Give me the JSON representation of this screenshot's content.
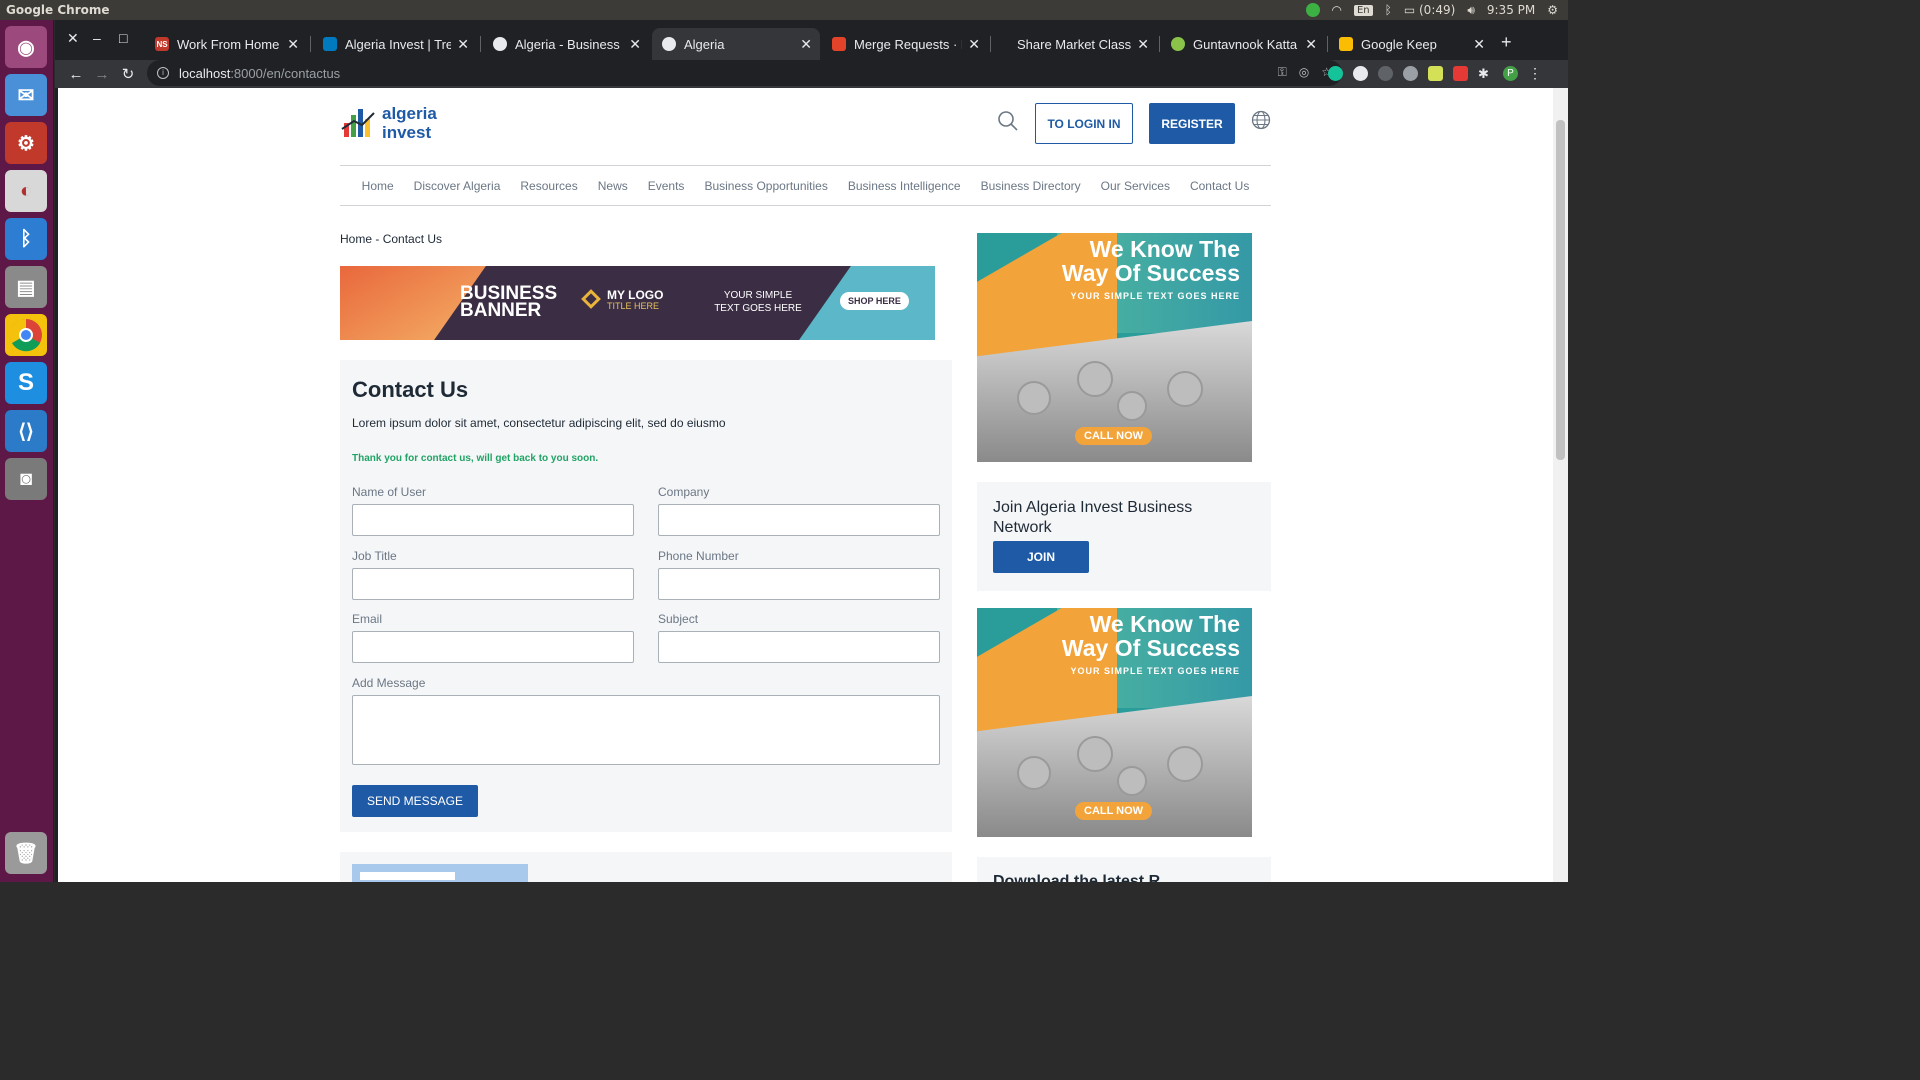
{
  "os": {
    "app_title": "Google Chrome",
    "battery": "(0:49)",
    "keyboard": "En",
    "clock": "9:35 PM"
  },
  "browser": {
    "tabs": [
      {
        "title": "Work From Home",
        "favicon": "NS"
      },
      {
        "title": "Algeria Invest | Trello"
      },
      {
        "title": "Algeria - Business Op"
      },
      {
        "title": "Algeria"
      },
      {
        "title": "Merge Requests · La"
      },
      {
        "title": "Share Market Classes"
      },
      {
        "title": "Guntavnook Katta"
      },
      {
        "title": "Google Keep"
      }
    ],
    "url_host": "localhost",
    "url_rest": ":8000/en/contactus",
    "profile_initial": "P"
  },
  "header": {
    "logo_line1": "algeria",
    "logo_line2": "invest",
    "login_label": "TO LOGIN IN",
    "register_label": "REGISTER"
  },
  "nav": {
    "items": [
      "Home",
      "Discover Algeria",
      "Resources",
      "News",
      "Events",
      "Business Opportunities",
      "Business Intelligence",
      "Business Directory",
      "Our Services",
      "Contact Us"
    ]
  },
  "breadcrumb": {
    "home": "Home",
    "separator": "-",
    "current": "Contact Us"
  },
  "banner": {
    "title": "BUSINESS BANNER",
    "logo": "MY LOGO",
    "logo_sub": "TITLE HERE",
    "simple_text": "YOUR SIMPLE TEXT GOES HERE",
    "shop": "SHOP HERE"
  },
  "contact": {
    "title": "Contact Us",
    "intro": "Lorem ipsum dolor sit amet, consectetur adipiscing elit, sed do eiusmo",
    "thanks": "Thank you for contact us, will get back to you soon.",
    "fields": {
      "name": "Name of User",
      "company": "Company",
      "job": "Job Title",
      "phone": "Phone Number",
      "email": "Email",
      "subject": "Subject",
      "message": "Add Message"
    },
    "send_label": "SEND MESSAGE"
  },
  "sidebar": {
    "ad_title": "We Know The Way Of Success",
    "ad_sub": "YOUR SIMPLE TEXT GOES HERE",
    "ad_cta": "CALL NOW",
    "join_title": "Join Algeria Invest Business Network",
    "join_label": "JOIN",
    "download_title": "Download the latest R..."
  },
  "colors": {
    "brand_blue": "#1f5aa6",
    "success_green": "#21a366",
    "launcher": "#5e1847"
  }
}
